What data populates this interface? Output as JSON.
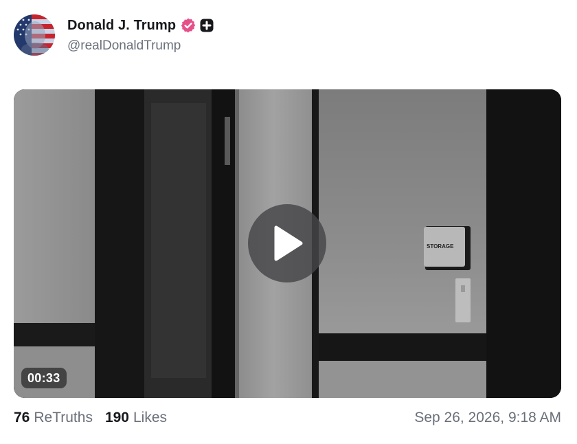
{
  "author": {
    "display_name": "Donald J. Trump",
    "handle": "@realDonaldTrump",
    "avatar_icon": "flag-portrait-avatar",
    "verified_icon": "verified-badge-icon",
    "verified_color": "#e6508a",
    "plus_icon": "plus-badge-icon"
  },
  "media": {
    "type": "video",
    "duration": "00:33",
    "sign_text": "STORAGE",
    "play_icon": "play-icon"
  },
  "stats": {
    "retruths_count": "76",
    "retruths_label": "ReTruths",
    "likes_count": "190",
    "likes_label": "Likes"
  },
  "timestamp": "Sep 26, 2026, 9:18 AM"
}
